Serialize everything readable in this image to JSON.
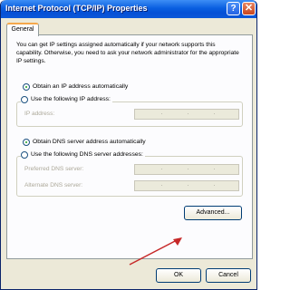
{
  "window": {
    "title": "Internet Protocol (TCP/IP) Properties",
    "help_label": "?",
    "close_label": "✕"
  },
  "tabs": [
    {
      "label": "General"
    }
  ],
  "general": {
    "description": "You can get IP settings assigned automatically if your network supports this capability. Otherwise, you need to ask your network administrator for the appropriate IP settings.",
    "ip_auto_label": "Obtain an IP address automatically",
    "ip_manual_label": "Use the following IP address:",
    "ip_address_label": "IP address:",
    "ip_auto_selected": true,
    "dns_auto_label": "Obtain DNS server address automatically",
    "dns_manual_label": "Use the following DNS server addresses:",
    "preferred_dns_label": "Preferred DNS server:",
    "alternate_dns_label": "Alternate DNS server:",
    "dns_auto_selected": true,
    "advanced_label": "Advanced..."
  },
  "footer": {
    "ok_label": "OK",
    "cancel_label": "Cancel"
  },
  "colors": {
    "titlebar": "#0a5fe0",
    "annotation_arrow": "#c62828",
    "tab_highlight": "#f5a84b"
  }
}
